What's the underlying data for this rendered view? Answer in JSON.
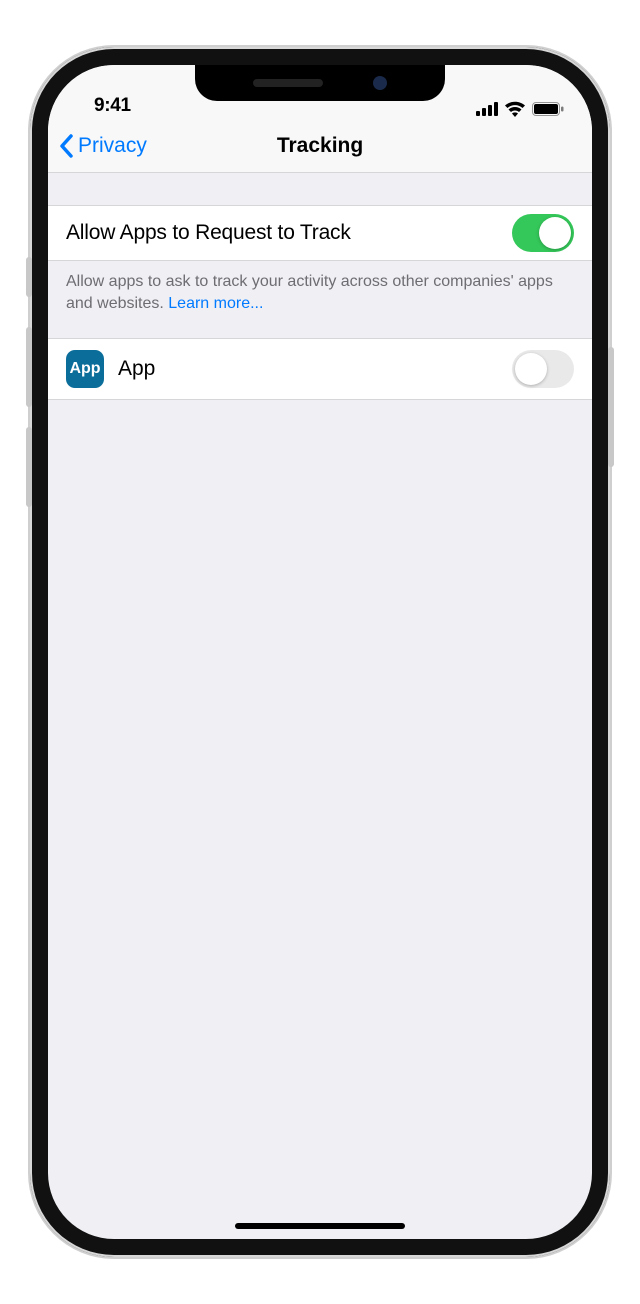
{
  "status": {
    "time": "9:41"
  },
  "nav": {
    "title": "Tracking",
    "back_label": "Privacy"
  },
  "settings": {
    "allow_label": "Allow Apps to Request to Track",
    "allow_on": true,
    "footer_text": "Allow apps to ask to track your activity across other companies' apps and websites. ",
    "learn_more": "Learn more..."
  },
  "apps": [
    {
      "name": "App",
      "icon_text": "App",
      "tracking_on": false
    }
  ]
}
